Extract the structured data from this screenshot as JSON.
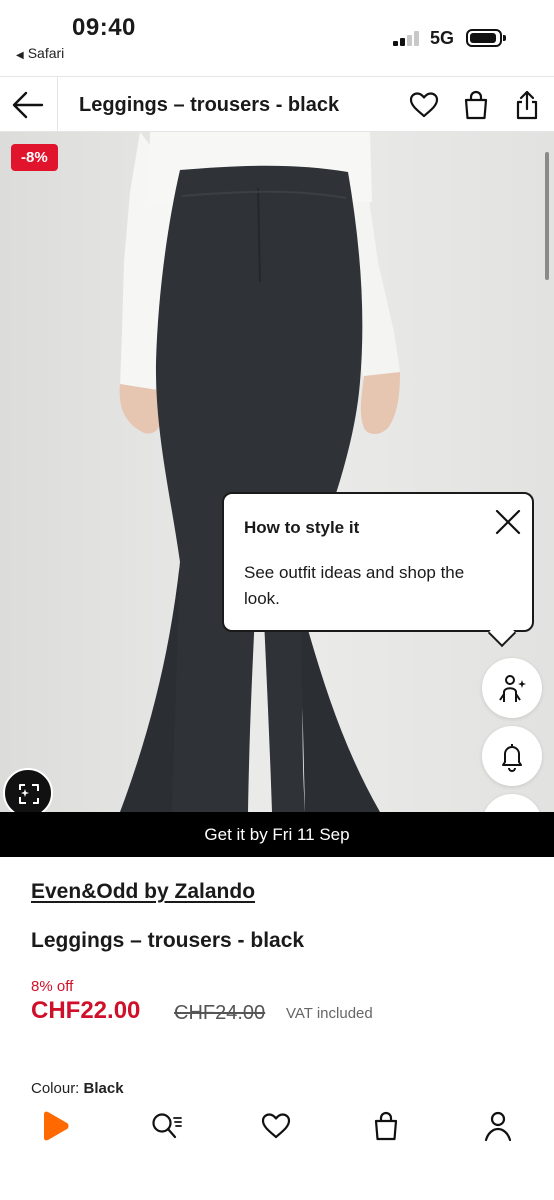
{
  "status_bar": {
    "time": "09:40",
    "back_app": "Safari",
    "network": "5G"
  },
  "header": {
    "title": "Leggings – trousers - black",
    "icons": [
      "back-arrow-icon",
      "heart-icon",
      "bag-icon",
      "share-icon"
    ]
  },
  "hero": {
    "discount_badge": "-8%",
    "tooltip": {
      "title": "How to style it",
      "body": "See outfit ideas and shop the look."
    },
    "fab_icons": [
      "style-ideas-icon",
      "bell-icon"
    ]
  },
  "delivery": {
    "text": "Get it by Fri 11 Sep"
  },
  "product": {
    "brand": "Even&Odd by Zalando",
    "name": "Leggings – trousers - black",
    "discount_text": "8% off",
    "price": "CHF22.00",
    "original_price": "CHF24.00",
    "vat": "VAT included",
    "colour_label": "Colour:",
    "colour_value": "Black"
  },
  "bottom_nav": {
    "items": [
      "home-icon",
      "search-icon",
      "wishlist-icon",
      "bag-icon",
      "profile-icon"
    ],
    "accent_color": "#ff6900"
  },
  "colors": {
    "sale_red": "#d0102a",
    "badge_red": "#e0152d",
    "text": "#1a1a1a"
  }
}
